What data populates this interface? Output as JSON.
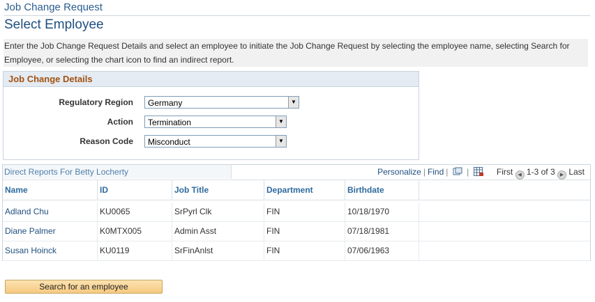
{
  "breadcrumb": "Job Change Request",
  "page_title": "Select Employee",
  "instructions": "Enter the Job Change Request Details and select an employee to initiate the Job Change Request by selecting the employee name, selecting Search for Employee, or selecting the chart icon to find an indirect report.",
  "details": {
    "heading": "Job Change Details",
    "fields": [
      {
        "label": "Regulatory Region",
        "value": "Germany"
      },
      {
        "label": "Action",
        "value": "Termination"
      },
      {
        "label": "Reason Code",
        "value": "Misconduct"
      }
    ]
  },
  "grid": {
    "title": "Direct Reports For Betty Locherty",
    "personalize": "Personalize",
    "find": "Find",
    "first": "First",
    "range": "1-3 of 3",
    "last": "Last",
    "columns": [
      "Name",
      "ID",
      "Job Title",
      "Department",
      "Birthdate"
    ],
    "rows": [
      {
        "name": "Adland Chu",
        "id": "KU0065",
        "job_title": "SrPyrl Clk",
        "department": "FIN",
        "birthdate": "10/18/1970"
      },
      {
        "name": "Diane Palmer",
        "id": "K0MTX005",
        "job_title": "Admin Asst",
        "department": "FIN",
        "birthdate": "07/18/1981"
      },
      {
        "name": "Susan Hoinck",
        "id": "KU0119",
        "job_title": "SrFinAnlst",
        "department": "FIN",
        "birthdate": "07/06/1963"
      }
    ]
  },
  "search_button": "Search for an employee",
  "colors": {
    "accent": "#1f4f7e",
    "section_heading": "#a35212",
    "button": "#f6c981"
  }
}
